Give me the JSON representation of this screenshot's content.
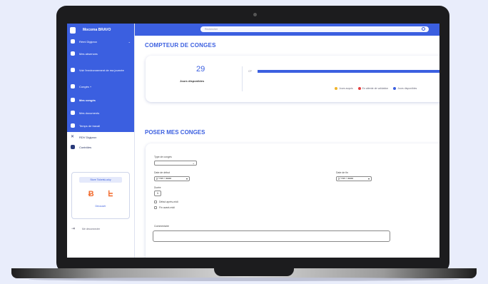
{
  "app": {
    "name": "Mocoma BRAVO"
  },
  "user": {
    "name": "Rémi Digiprox"
  },
  "sidebar": {
    "items": [
      {
        "label": "Mes absences"
      },
      {
        "label": "Voir l'environnement de ma journée"
      },
      {
        "label": "Congés +"
      },
      {
        "label": "Mes congés"
      },
      {
        "label": "Mes documents"
      },
      {
        "label": "Temps de travail"
      }
    ],
    "items_below": [
      {
        "label": "RDV Digiprox"
      },
      {
        "label": "Contrôles"
      }
    ],
    "widget": {
      "title": "Store TicketsLucky",
      "link": "Découvrir"
    },
    "logout": "Me déconnecter"
  },
  "search": {
    "placeholder": "Rechercher"
  },
  "counter": {
    "title": "COMPTEUR DE CONGES",
    "value": "29",
    "label": "Jours disponibles",
    "bar_label": "CP",
    "legend": [
      {
        "label": "Jours acquis",
        "color": "#f0b429"
      },
      {
        "label": "En attente de validation",
        "color": "#e53e3e"
      },
      {
        "label": "Jours disponibles",
        "color": "#3b5fe0"
      }
    ]
  },
  "form": {
    "title": "POSER MES CONGES",
    "type_label": "Type de congés",
    "start_label": "Date de début",
    "start_value": "jj / mm / aaaa",
    "end_label": "Date de fin",
    "end_value": "jj / mm / aaaa",
    "duration_label": "Durée",
    "duration_value": "1",
    "option1": "Début après-midi",
    "option2": "Fin avant-midi",
    "comment_label": "Commentaire"
  },
  "colors": {
    "accent": "#3b5fe0",
    "orange": "#f26b2d"
  }
}
